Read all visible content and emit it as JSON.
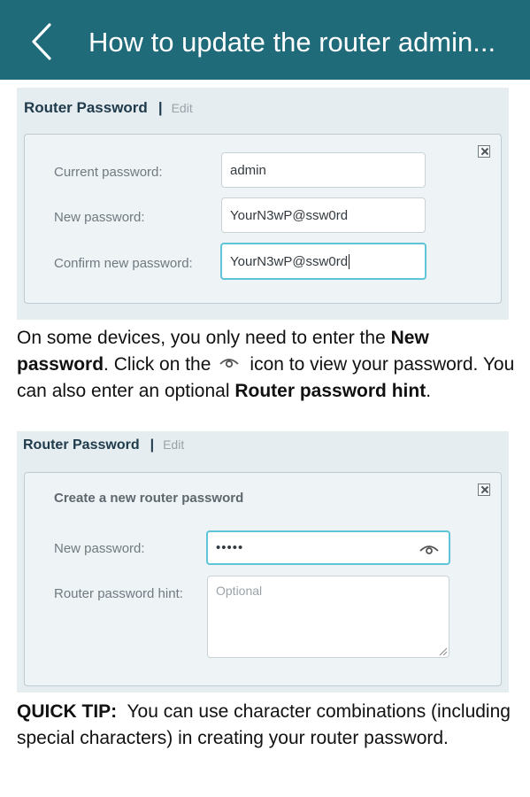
{
  "header": {
    "title": "How to update the router admin..."
  },
  "shot1": {
    "section_title": "Router Password",
    "separator": "|",
    "edit_label": "Edit",
    "fields": [
      {
        "label": "Current password:",
        "value": "admin"
      },
      {
        "label": "New password:",
        "value": "YourN3wP@ssw0rd"
      },
      {
        "label": "Confirm new password:",
        "value": "YourN3wP@ssw0rd"
      }
    ]
  },
  "para1": {
    "t1": "On some devices, you only need to enter the ",
    "b1": "New password",
    "t2": ".  Click on the",
    "t3": "icon to view your password.  You can also enter an optional ",
    "b2": "Router password hint",
    "t4": "."
  },
  "shot2": {
    "section_title": "Router Password",
    "separator": "|",
    "edit_label": "Edit",
    "panel_title": "Create a new router password",
    "new_password_label": "New password:",
    "new_password_value": "•••••",
    "hint_label": "Router password hint:",
    "hint_placeholder": "Optional"
  },
  "tip": {
    "label": "QUICK TIP:",
    "text": "  You can use character combinations (including special characters) in creating your router password."
  },
  "icons": {
    "back": "back-arrow-icon",
    "close": "close-x-icon",
    "eye": "eye-icon",
    "resize": "resize-grip-icon"
  },
  "colors": {
    "topbar": "#1f6b7a",
    "screenshot_bg": "#e6edf1",
    "focus_border": "#5fc4d8"
  }
}
